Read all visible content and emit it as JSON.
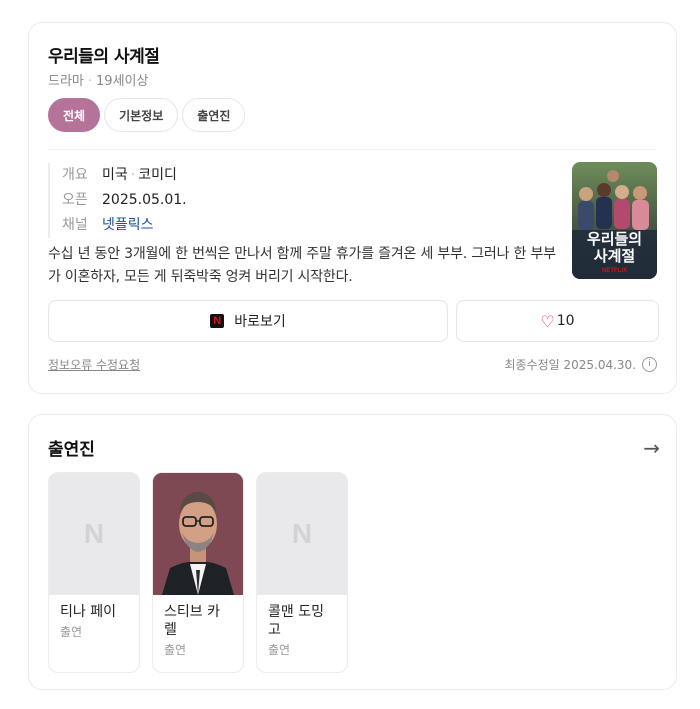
{
  "show": {
    "title": "우리들의 사계절",
    "genre": "드라마",
    "rating": "19세이상",
    "poster_text": "우리들의 사계절"
  },
  "tabs": [
    "전체",
    "기본정보",
    "출연진"
  ],
  "info": {
    "overview_label": "개요",
    "country": "미국",
    "category": "코미디",
    "open_label": "오픈",
    "open_date": "2025.05.01.",
    "channel_label": "채널",
    "channel": "넷플릭스"
  },
  "synopsis": "수십 년 동안 3개월에 한 번씩은 만나서 함께 주말 휴가를 즐겨온 세 부부. 그러나 한 부부가 이혼하자, 모든 게 뒤죽박죽 엉켜 버리기 시작한다.",
  "actions": {
    "watch_label": "바로보기",
    "like_count": "10"
  },
  "footer": {
    "report_label": "정보오류 수정요청",
    "updated_text": "최종수정일 2025.04.30."
  },
  "cast_section": {
    "title": "출연진",
    "members": [
      {
        "name": "티나 페이",
        "role": "출연"
      },
      {
        "name": "스티브 카렐",
        "role": "출연"
      },
      {
        "name": "콜맨 도밍고",
        "role": "출연"
      }
    ]
  },
  "colors": {
    "accent": "#b5739a",
    "link": "#1a4fa0",
    "heart": "#e0245e"
  }
}
